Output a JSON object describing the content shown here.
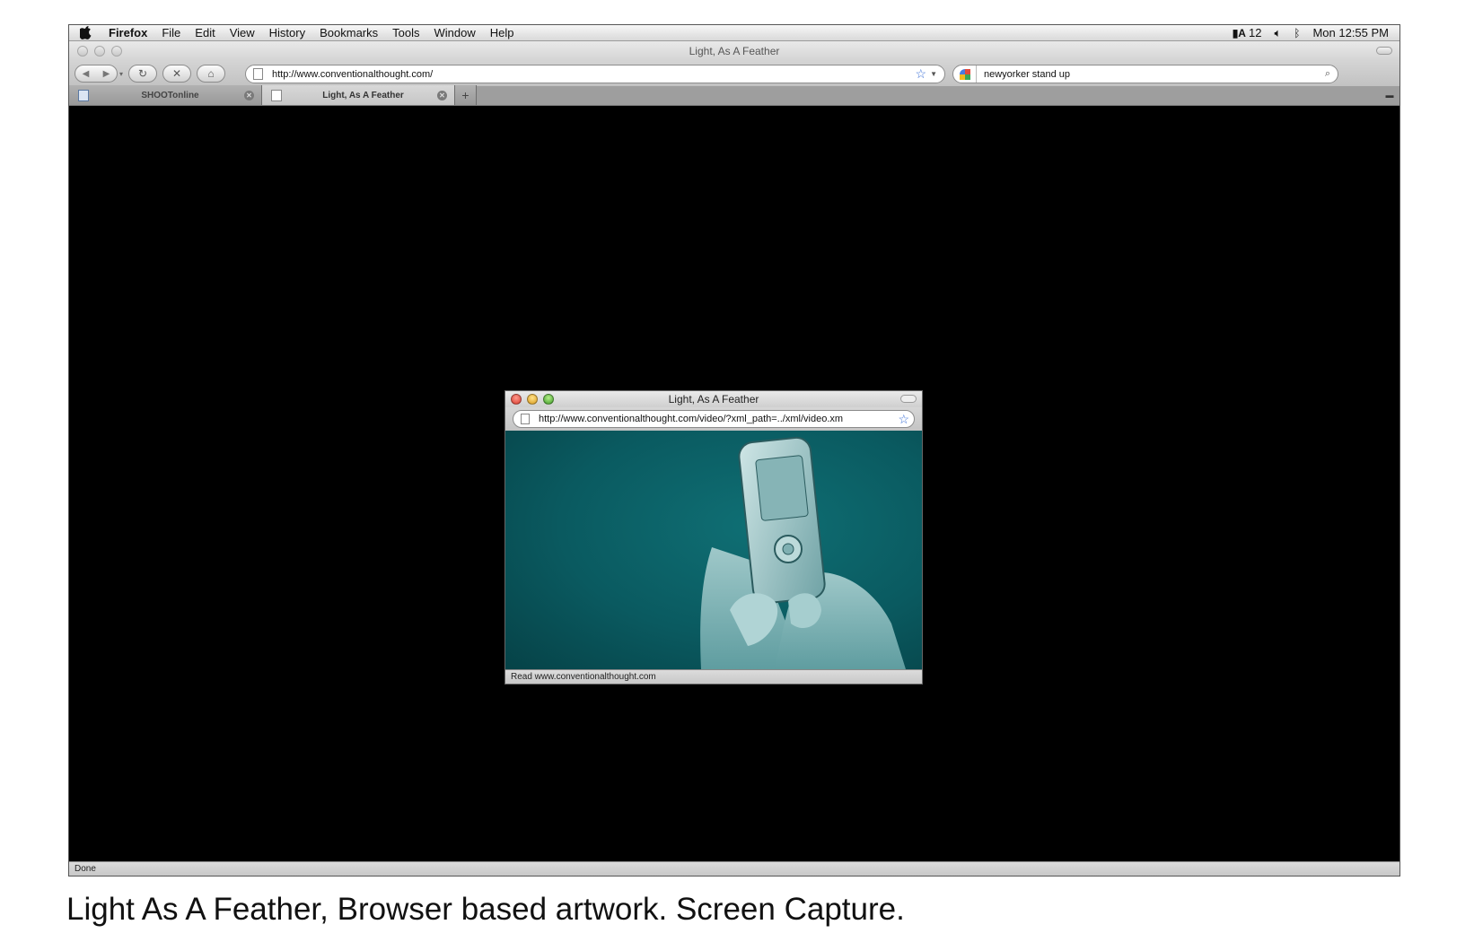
{
  "menubar": {
    "apple_icon": "apple-icon",
    "app": "Firefox",
    "items": [
      "File",
      "Edit",
      "View",
      "History",
      "Bookmarks",
      "Tools",
      "Window",
      "Help"
    ],
    "status_num": "12",
    "clock": "Mon 12:55 PM"
  },
  "window": {
    "title": "Light, As A Feather"
  },
  "toolbar": {
    "url": "http://www.conventionalthought.com/",
    "search_value": "newyorker stand up"
  },
  "tabs": [
    {
      "label": "SHOOTonline",
      "active": false
    },
    {
      "label": "Light, As A Feather",
      "active": true
    }
  ],
  "newtab_label": "+",
  "status": "Done",
  "popup": {
    "title": "Light, As A Feather",
    "url": "http://www.conventionalthought.com/video/?xml_path=../xml/video.xm",
    "status": "Read www.conventionalthought.com"
  },
  "caption": "Light As A Feather, Browser based artwork. Screen Capture."
}
